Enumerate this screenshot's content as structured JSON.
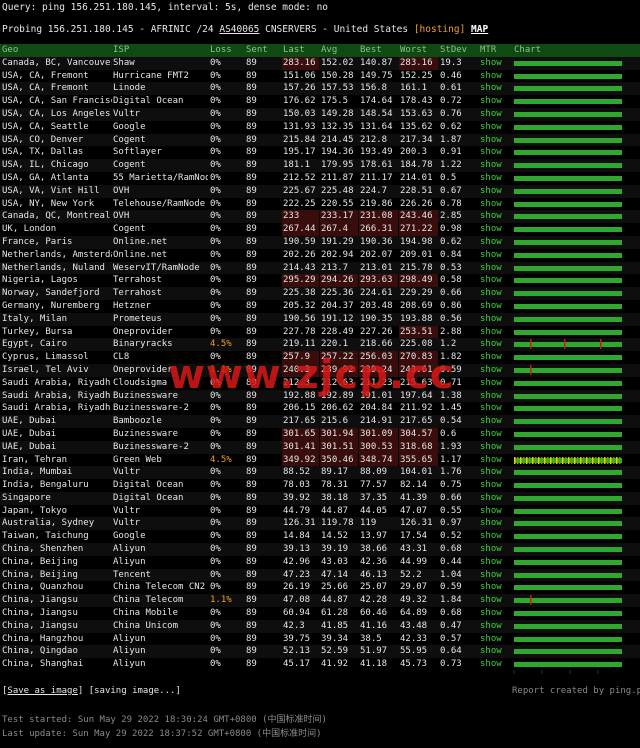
{
  "query_line": "Query: ping 156.251.180.145, interval: 5s, dense mode: no",
  "probe": {
    "prefix": "Probing 156.251.180.145 - AFRINIC /24 ",
    "asn": "AS40065",
    "org": " CNSERVERS - United States ",
    "hosting": "[hosting]",
    "map": "MAP"
  },
  "headers": {
    "geo": "Geo",
    "isp": "ISP",
    "loss": "Loss",
    "sent": "Sent",
    "last": "Last",
    "avg": "Avg",
    "best": "Best",
    "worst": "Worst",
    "stdev": "StDev",
    "mtr": "MTR",
    "chart": "Chart"
  },
  "rows": [
    {
      "geo": "Canada, BC, Vancouver",
      "isp": "Shaw",
      "loss": "0%",
      "sent": "89",
      "last": "283.16",
      "avg": "152.02",
      "best": "140.87",
      "worst": "283.16",
      "stdev": "19.3",
      "mtr": "show"
    },
    {
      "geo": "USA, CA, Fremont",
      "isp": "Hurricane FMT2",
      "loss": "0%",
      "sent": "89",
      "last": "151.06",
      "avg": "150.28",
      "best": "149.75",
      "worst": "152.25",
      "stdev": "0.46",
      "mtr": "show"
    },
    {
      "geo": "USA, CA, Fremont",
      "isp": "Linode",
      "loss": "0%",
      "sent": "89",
      "last": "157.26",
      "avg": "157.53",
      "best": "156.8",
      "worst": "161.1",
      "stdev": "0.61",
      "mtr": "show"
    },
    {
      "geo": "USA, CA, San Francisco",
      "isp": "Digital Ocean",
      "loss": "0%",
      "sent": "89",
      "last": "176.62",
      "avg": "175.5",
      "best": "174.64",
      "worst": "178.43",
      "stdev": "0.72",
      "mtr": "show"
    },
    {
      "geo": "USA, CA, Los Angeles",
      "isp": "Vultr",
      "loss": "0%",
      "sent": "89",
      "last": "150.03",
      "avg": "149.28",
      "best": "148.54",
      "worst": "153.63",
      "stdev": "0.76",
      "mtr": "show"
    },
    {
      "geo": "USA, CA, Seattle",
      "isp": "Google",
      "loss": "0%",
      "sent": "89",
      "last": "131.93",
      "avg": "132.35",
      "best": "131.64",
      "worst": "135.62",
      "stdev": "0.62",
      "mtr": "show"
    },
    {
      "geo": "USA, CO, Denver",
      "isp": "Cogent",
      "loss": "0%",
      "sent": "89",
      "last": "215.84",
      "avg": "214.45",
      "best": "212.8",
      "worst": "217.34",
      "stdev": "1.87",
      "mtr": "show"
    },
    {
      "geo": "USA, TX, Dallas",
      "isp": "Softlayer",
      "loss": "0%",
      "sent": "89",
      "last": "195.17",
      "avg": "194.36",
      "best": "193.49",
      "worst": "200.3",
      "stdev": "0.91",
      "mtr": "show"
    },
    {
      "geo": "USA, IL, Chicago",
      "isp": "Cogent",
      "loss": "0%",
      "sent": "89",
      "last": "181.1",
      "avg": "179.95",
      "best": "178.61",
      "worst": "184.78",
      "stdev": "1.22",
      "mtr": "show"
    },
    {
      "geo": "USA, GA, Atlanta",
      "isp": "55 Marietta/RamNode",
      "loss": "0%",
      "sent": "89",
      "last": "212.52",
      "avg": "211.87",
      "best": "211.17",
      "worst": "214.01",
      "stdev": "0.5",
      "mtr": "show"
    },
    {
      "geo": "USA, VA, Vint Hill",
      "isp": "OVH",
      "loss": "0%",
      "sent": "89",
      "last": "225.67",
      "avg": "225.48",
      "best": "224.7",
      "worst": "228.51",
      "stdev": "0.67",
      "mtr": "show"
    },
    {
      "geo": "USA, NY, New York",
      "isp": "Telehouse/RamNode",
      "loss": "0%",
      "sent": "89",
      "last": "222.25",
      "avg": "220.55",
      "best": "219.86",
      "worst": "226.26",
      "stdev": "0.78",
      "mtr": "show"
    },
    {
      "geo": "Canada, QC, Montreal",
      "isp": "OVH",
      "loss": "0%",
      "sent": "89",
      "last": "233",
      "avg": "233.17",
      "best": "231.08",
      "worst": "243.46",
      "stdev": "2.85",
      "mtr": "show"
    },
    {
      "geo": "UK, London",
      "isp": "Cogent",
      "loss": "0%",
      "sent": "89",
      "last": "267.44",
      "avg": "267.4",
      "best": "266.31",
      "worst": "271.22",
      "stdev": "0.98",
      "mtr": "show"
    },
    {
      "geo": "France, Paris",
      "isp": "Online.net",
      "loss": "0%",
      "sent": "89",
      "last": "190.59",
      "avg": "191.29",
      "best": "190.36",
      "worst": "194.98",
      "stdev": "0.62",
      "mtr": "show"
    },
    {
      "geo": "Netherlands, Amsterdam",
      "isp": "Online.net",
      "loss": "0%",
      "sent": "89",
      "last": "202.26",
      "avg": "202.94",
      "best": "202.07",
      "worst": "209.01",
      "stdev": "0.84",
      "mtr": "show"
    },
    {
      "geo": "Netherlands, Nuland",
      "isp": "WeservIT/RamNode",
      "loss": "0%",
      "sent": "89",
      "last": "214.43",
      "avg": "213.7",
      "best": "213.01",
      "worst": "215.78",
      "stdev": "0.53",
      "mtr": "show"
    },
    {
      "geo": "Nigeria, Lagos",
      "isp": "Terrahost",
      "loss": "0%",
      "sent": "89",
      "last": "295.29",
      "avg": "294.26",
      "best": "293.63",
      "worst": "298.49",
      "stdev": "0.58",
      "mtr": "show"
    },
    {
      "geo": "Norway, Sandefjord",
      "isp": "Terrahost",
      "loss": "0%",
      "sent": "89",
      "last": "225.38",
      "avg": "225.36",
      "best": "224.61",
      "worst": "229.29",
      "stdev": "0.66",
      "mtr": "show"
    },
    {
      "geo": "Germany, Nuremberg",
      "isp": "Hetzner",
      "loss": "0%",
      "sent": "89",
      "last": "205.32",
      "avg": "204.37",
      "best": "203.48",
      "worst": "208.69",
      "stdev": "0.86",
      "mtr": "show"
    },
    {
      "geo": "Italy, Milan",
      "isp": "Prometeus",
      "loss": "0%",
      "sent": "89",
      "last": "190.56",
      "avg": "191.12",
      "best": "190.35",
      "worst": "193.88",
      "stdev": "0.56",
      "mtr": "show"
    },
    {
      "geo": "Turkey, Bursa",
      "isp": "Oneprovider",
      "loss": "0%",
      "sent": "89",
      "last": "227.78",
      "avg": "228.49",
      "best": "227.26",
      "worst": "253.51",
      "stdev": "2.88",
      "mtr": "show"
    },
    {
      "geo": "Egypt, Cairo",
      "isp": "Binaryracks",
      "loss": "4.5%",
      "sent": "89",
      "last": "219.11",
      "avg": "220.1",
      "best": "218.66",
      "worst": "225.08",
      "stdev": "1.2",
      "mtr": "show"
    },
    {
      "geo": "Cyprus, Limassol",
      "isp": "CL8",
      "loss": "0%",
      "sent": "89",
      "last": "257.9",
      "avg": "257.22",
      "best": "256.03",
      "worst": "270.83",
      "stdev": "1.82",
      "mtr": "show"
    },
    {
      "geo": "Israel, Tel Aviv",
      "isp": "Oneprovider",
      "loss": "1.1%",
      "sent": "89",
      "last": "240.3",
      "avg": "239.92",
      "best": "239.24",
      "worst": "243.61",
      "stdev": "0.59",
      "mtr": "show"
    },
    {
      "geo": "Saudi Arabia, Riyadh",
      "isp": "Cloudsigma",
      "loss": "0%",
      "sent": "89",
      "last": "212.3",
      "avg": "212.63",
      "best": "211.23",
      "worst": "215.63",
      "stdev": "0.71",
      "mtr": "show"
    },
    {
      "geo": "Saudi Arabia, Riyadh",
      "isp": "Buzinessware",
      "loss": "0%",
      "sent": "89",
      "last": "192.88",
      "avg": "192.89",
      "best": "191.01",
      "worst": "197.64",
      "stdev": "1.38",
      "mtr": "show"
    },
    {
      "geo": "Saudi Arabia, Riyadh",
      "isp": "Buzinessware-2",
      "loss": "0%",
      "sent": "89",
      "last": "206.15",
      "avg": "206.62",
      "best": "204.84",
      "worst": "211.92",
      "stdev": "1.45",
      "mtr": "show"
    },
    {
      "geo": "UAE, Dubai",
      "isp": "Bamboozle",
      "loss": "0%",
      "sent": "89",
      "last": "217.65",
      "avg": "215.6",
      "best": "214.91",
      "worst": "217.65",
      "stdev": "0.54",
      "mtr": "show"
    },
    {
      "geo": "UAE, Dubai",
      "isp": "Buzinessware",
      "loss": "0%",
      "sent": "89",
      "last": "301.65",
      "avg": "301.94",
      "best": "301.09",
      "worst": "304.57",
      "stdev": "0.6",
      "mtr": "show"
    },
    {
      "geo": "UAE, Dubai",
      "isp": "Buzinessware-2",
      "loss": "0%",
      "sent": "89",
      "last": "301.41",
      "avg": "301.51",
      "best": "300.53",
      "worst": "318.68",
      "stdev": "1.93",
      "mtr": "show"
    },
    {
      "geo": "Iran, Tehran",
      "isp": "Green Web",
      "loss": "4.5%",
      "sent": "89",
      "last": "349.92",
      "avg": "350.46",
      "best": "348.74",
      "worst": "355.65",
      "stdev": "1.17",
      "mtr": "show"
    },
    {
      "geo": "India, Mumbai",
      "isp": "Vultr",
      "loss": "0%",
      "sent": "89",
      "last": "88.52",
      "avg": "89.17",
      "best": "88.09",
      "worst": "104.01",
      "stdev": "1.76",
      "mtr": "show"
    },
    {
      "geo": "India, Bengaluru",
      "isp": "Digital Ocean",
      "loss": "0%",
      "sent": "89",
      "last": "78.03",
      "avg": "78.31",
      "best": "77.57",
      "worst": "82.14",
      "stdev": "0.75",
      "mtr": "show"
    },
    {
      "geo": "Singapore",
      "isp": "Digital Ocean",
      "loss": "0%",
      "sent": "89",
      "last": "39.92",
      "avg": "38.18",
      "best": "37.35",
      "worst": "41.39",
      "stdev": "0.66",
      "mtr": "show"
    },
    {
      "geo": "Japan, Tokyo",
      "isp": "Vultr",
      "loss": "0%",
      "sent": "89",
      "last": "44.79",
      "avg": "44.87",
      "best": "44.05",
      "worst": "47.07",
      "stdev": "0.55",
      "mtr": "show"
    },
    {
      "geo": "Australia, Sydney",
      "isp": "Vultr",
      "loss": "0%",
      "sent": "89",
      "last": "126.31",
      "avg": "119.78",
      "best": "119",
      "worst": "126.31",
      "stdev": "0.97",
      "mtr": "show"
    },
    {
      "geo": "Taiwan, Taichung",
      "isp": "Google",
      "loss": "0%",
      "sent": "89",
      "last": "14.84",
      "avg": "14.52",
      "best": "13.97",
      "worst": "17.54",
      "stdev": "0.52",
      "mtr": "show"
    },
    {
      "geo": "China, Shenzhen",
      "isp": "Aliyun",
      "loss": "0%",
      "sent": "89",
      "last": "39.13",
      "avg": "39.19",
      "best": "38.66",
      "worst": "43.31",
      "stdev": "0.68",
      "mtr": "show"
    },
    {
      "geo": "China, Beijing",
      "isp": "Aliyun",
      "loss": "0%",
      "sent": "89",
      "last": "42.96",
      "avg": "43.03",
      "best": "42.36",
      "worst": "44.99",
      "stdev": "0.44",
      "mtr": "show"
    },
    {
      "geo": "China, Beijing",
      "isp": "Tencent",
      "loss": "0%",
      "sent": "89",
      "last": "47.23",
      "avg": "47.14",
      "best": "46.13",
      "worst": "52.2",
      "stdev": "1.04",
      "mtr": "show"
    },
    {
      "geo": "China, Quanzhou",
      "isp": "China Telecom CN2",
      "loss": "0%",
      "sent": "89",
      "last": "26.19",
      "avg": "25.66",
      "best": "25.07",
      "worst": "29.07",
      "stdev": "0.59",
      "mtr": "show"
    },
    {
      "geo": "China, Jiangsu",
      "isp": "China Telecom",
      "loss": "1.1%",
      "sent": "89",
      "last": "47.08",
      "avg": "44.87",
      "best": "42.28",
      "worst": "49.32",
      "stdev": "1.84",
      "mtr": "show"
    },
    {
      "geo": "China, Jiangsu",
      "isp": "China Mobile",
      "loss": "0%",
      "sent": "89",
      "last": "60.94",
      "avg": "61.28",
      "best": "60.46",
      "worst": "64.89",
      "stdev": "0.68",
      "mtr": "show"
    },
    {
      "geo": "China, Jiangsu",
      "isp": "China Unicom",
      "loss": "0%",
      "sent": "89",
      "last": "42.3",
      "avg": "41.85",
      "best": "41.16",
      "worst": "43.48",
      "stdev": "0.47",
      "mtr": "show"
    },
    {
      "geo": "China, Hangzhou",
      "isp": "Aliyun",
      "loss": "0%",
      "sent": "89",
      "last": "39.75",
      "avg": "39.34",
      "best": "38.5",
      "worst": "42.33",
      "stdev": "0.57",
      "mtr": "show"
    },
    {
      "geo": "China, Qingdao",
      "isp": "Aliyun",
      "loss": "0%",
      "sent": "89",
      "last": "52.13",
      "avg": "52.59",
      "best": "51.97",
      "worst": "55.95",
      "stdev": "0.64",
      "mtr": "show"
    },
    {
      "geo": "China, Shanghai",
      "isp": "Aliyun",
      "loss": "0%",
      "sent": "89",
      "last": "45.17",
      "avg": "41.92",
      "best": "41.18",
      "worst": "45.73",
      "stdev": "0.73",
      "mtr": "show"
    }
  ],
  "watermark": "www.zjcp.cc",
  "save_link": "Save as image",
  "saving": " [saving image...]",
  "credit": "Report created by ping.pe",
  "test_started": "Test started: Sun May 29 2022 18:30:24 GMT+0800 (中国标准时间)",
  "last_update": "Last update: Sun May 29 2022 18:37:52 GMT+0800 (中国标准时间)",
  "colors": {
    "bar": "#2ea82e",
    "loss_mark": "#d01818",
    "yellow": "#d8d800",
    "header_bg": "#0f4a12",
    "highlight": "#3a0d0d"
  }
}
